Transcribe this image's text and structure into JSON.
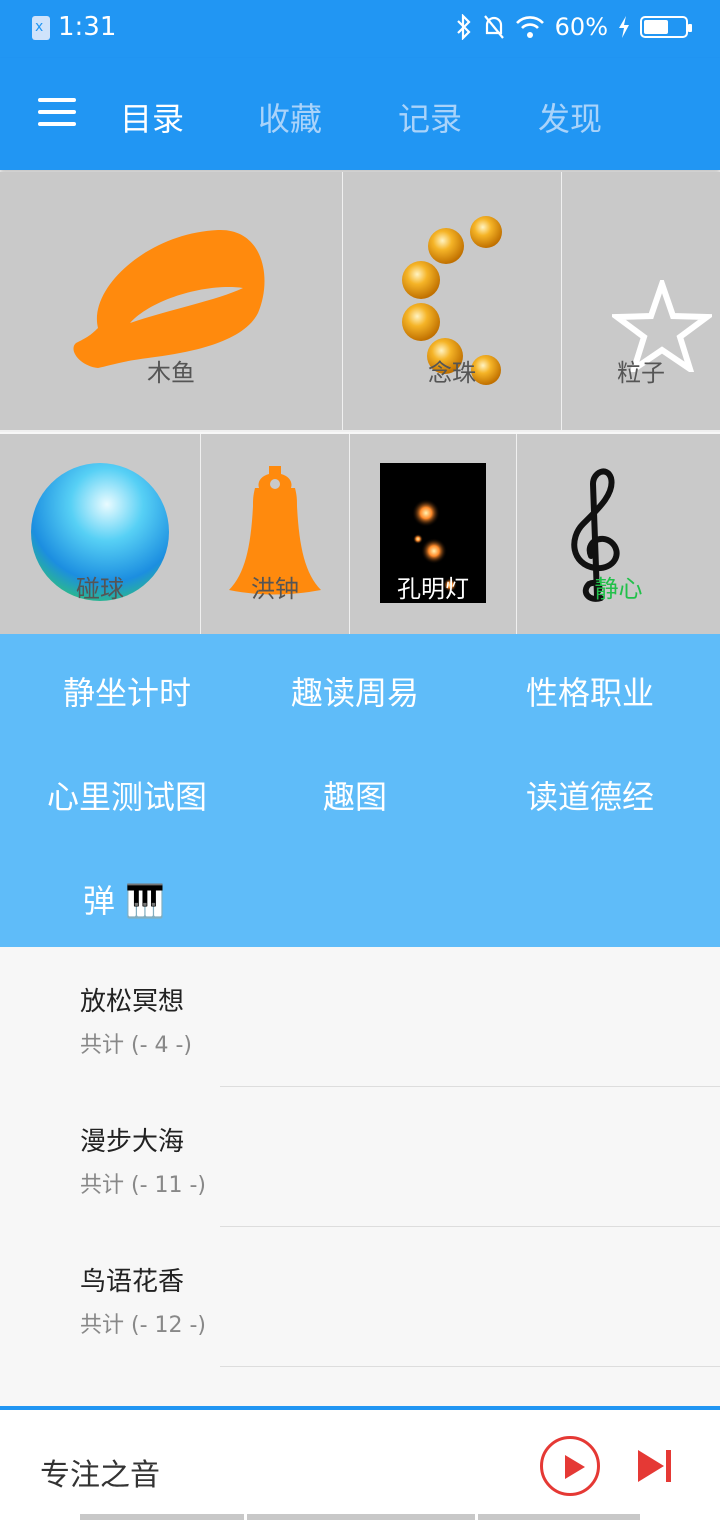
{
  "status": {
    "time": "1:31",
    "battery": "60%",
    "battery_level": 0.6
  },
  "tabs": [
    "目录",
    "收藏",
    "记录",
    "发现"
  ],
  "grid_row1": [
    {
      "label": "木鱼",
      "icon": "wooden-fish-icon"
    },
    {
      "label": "念珠",
      "icon": "prayer-beads-icon"
    },
    {
      "label": "粒子",
      "icon": "star-icon"
    }
  ],
  "grid_row2": [
    {
      "label": "碰球",
      "icon": "ball-icon"
    },
    {
      "label": "洪钟",
      "icon": "bell-icon"
    },
    {
      "label": "孔明灯",
      "icon": "sky-lantern-icon"
    },
    {
      "label": "静心",
      "icon": "treble-clef-icon"
    }
  ],
  "quick_links": [
    "静坐计时",
    "趣读周易",
    "性格职业",
    "心里测试图",
    "趣图",
    "读道德经",
    "弹 🎹"
  ],
  "lists": [
    {
      "title": "放松冥想",
      "count": "共计 (- 4 -)"
    },
    {
      "title": "漫步大海",
      "count": "共计 (- 11 -)"
    },
    {
      "title": "鸟语花香",
      "count": "共计 (- 12 -)"
    }
  ],
  "player": {
    "title": "专注之音"
  },
  "colors": {
    "primary": "#2196f3",
    "quick_bg": "#5fbcf9",
    "accent": "#e53935",
    "orange": "#ff8a0d"
  }
}
